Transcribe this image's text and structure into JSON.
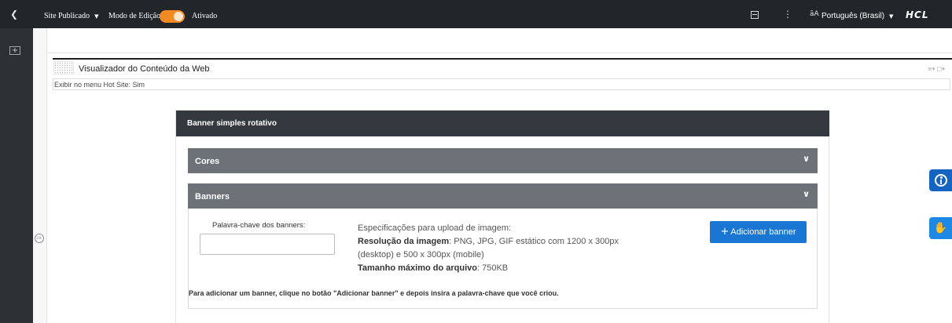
{
  "topbar": {
    "site_status": "Site Publicado",
    "edit_mode_label": "Modo de Edição:",
    "edit_mode_state": "Ativado",
    "edit_mode_on": true,
    "language": "Português (Brasil)",
    "brand": "HCL",
    "accent_color": "#f28a24"
  },
  "icons": {
    "back": "back-arrow-icon",
    "layout": "page-layout-icon",
    "more": "kebab-menu-icon",
    "translate": "translate-icon",
    "add": "add-content-icon",
    "expand": "expand-panel-icon",
    "accessibility": "accessibility-icon",
    "sign_language": "sign-language-icon"
  },
  "portlet": {
    "title": "Visualizador do Conteúdo da Web",
    "hot_site_line": "Exibir no menu Hot Site: Sim"
  },
  "banner_module": {
    "header": "Banner simples rotativo",
    "sections": [
      {
        "label": "Cores",
        "expanded": false
      },
      {
        "label": "Banners",
        "expanded": true
      }
    ],
    "keyword_label": "Palavra-chave dos banners:",
    "keyword_value": "",
    "specs_intro": "Especificações para upload de imagem:",
    "resolution_label": "Resolução da imagem",
    "resolution_value": ": PNG, JPG, GIF estático com 1200 x 300px (desktop) e 500 x 300px (mobile)",
    "max_size_label": "Tamanho máximo do arquivo",
    "max_size_value": ": 750KB",
    "add_button": "Adicionar banner",
    "help_text": "Para adicionar um banner, clique no botão \"Adicionar banner\" e depois insira a palavra-chave que você criou.",
    "button_color": "#1976d2"
  }
}
